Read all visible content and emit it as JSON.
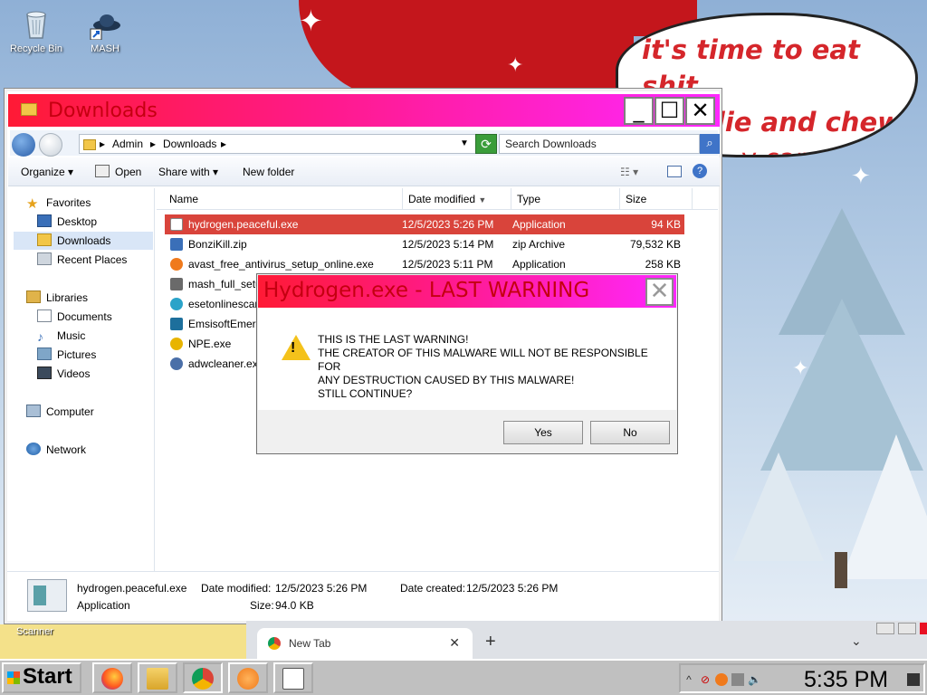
{
  "desktop": {
    "icons": [
      {
        "label": "Recycle Bin"
      },
      {
        "label": "MASH"
      }
    ],
    "wallpaper_text": [
      "it's time to eat shit",
      "and die and chew",
      "y canes"
    ],
    "partial_label": "Scanner"
  },
  "explorer": {
    "title": "Downloads",
    "window_buttons": {
      "minimize": "_",
      "maximize": "☐",
      "close": "✕"
    },
    "breadcrumb": [
      "Admin",
      "Downloads"
    ],
    "search_placeholder": "Search Downloads",
    "toolbar": {
      "organize": "Organize",
      "open": "Open",
      "share_with": "Share with",
      "new_folder": "New folder"
    },
    "nav": {
      "favorites": "Favorites",
      "favorites_items": [
        "Desktop",
        "Downloads",
        "Recent Places"
      ],
      "libraries": "Libraries",
      "libraries_items": [
        "Documents",
        "Music",
        "Pictures",
        "Videos"
      ],
      "computer": "Computer",
      "network": "Network"
    },
    "columns": {
      "name": "Name",
      "date": "Date modified",
      "type": "Type",
      "size": "Size"
    },
    "files": [
      {
        "name": "hydrogen.peaceful.exe",
        "date": "12/5/2023 5:26 PM",
        "type": "Application",
        "size": "94 KB",
        "selected": true,
        "icon_color": "#5aa0a8"
      },
      {
        "name": "BonziKill.zip",
        "date": "12/5/2023 5:14 PM",
        "type": "zip Archive",
        "size": "79,532 KB",
        "icon_color": "#3a6fb8"
      },
      {
        "name": "avast_free_antivirus_setup_online.exe",
        "date": "12/5/2023 5:11 PM",
        "type": "Application",
        "size": "258 KB",
        "icon_color": "#f07a1c"
      },
      {
        "name": "mash_full_setu",
        "icon_color": "#6a6a6a"
      },
      {
        "name": "esetonlinescar",
        "icon_color": "#2aa3c9"
      },
      {
        "name": "EmsisoftEmerg",
        "icon_color": "#1d6f9c"
      },
      {
        "name": "NPE.exe",
        "icon_color": "#e8b400"
      },
      {
        "name": "adwcleaner.exe",
        "icon_color": "#4a6fa8"
      }
    ],
    "details": {
      "name": "hydrogen.peaceful.exe",
      "type": "Application",
      "modified_label": "Date modified:",
      "modified": "12/5/2023 5:26 PM",
      "size_label": "Size:",
      "size": "94.0 KB",
      "created_label": "Date created:",
      "created": "12/5/2023 5:26 PM"
    }
  },
  "dialog": {
    "title": "Hydrogen.exe - LAST WARNING",
    "close": "✕",
    "message": [
      "THIS IS THE LAST WARNING!",
      "THE CREATOR OF THIS MALWARE WILL NOT BE RESPONSIBLE FOR",
      "ANY DESTRUCTION CAUSED BY THIS MALWARE!",
      "STILL CONTINUE?"
    ],
    "yes": "Yes",
    "no": "No"
  },
  "chrome": {
    "tab_title": "New Tab",
    "tab_close": "✕",
    "new_tab": "+",
    "chevron": "⌄"
  },
  "taskbar": {
    "start": "Start",
    "apps": [
      "firefox",
      "file-explorer",
      "chrome",
      "avast",
      "program"
    ],
    "clock": "5:35 PM"
  },
  "colors": {
    "title_gradient_start": "#ff1a35",
    "title_gradient_end": "#ff27ff",
    "title_text": "#c40010",
    "selected_row": "#d9443b"
  }
}
